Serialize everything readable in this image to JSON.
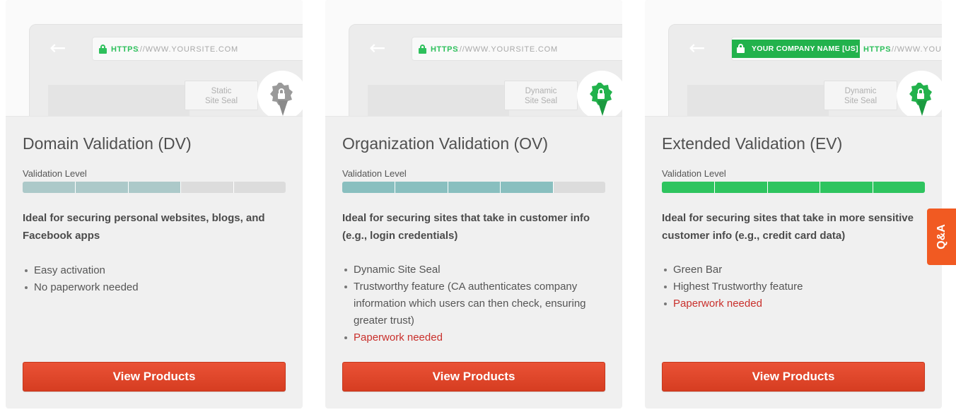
{
  "browser": {
    "https": "HTTPS",
    "domain": "://WWW.YOURSITE.COM",
    "domain_ev": "://WWW.YOU",
    "company": "YOUR COMPANY NAME [US]"
  },
  "cards": [
    {
      "title": "Domain Validation (DV)",
      "seal_line1": "Static",
      "seal_line2": "Site Seal",
      "seal_color": "#9a9a9a",
      "validation_label": "Validation Level",
      "validation_level": 0.6,
      "level_color": "#acc9c9",
      "description": "Ideal for securing personal websites, blogs, and Facebook apps",
      "features": [
        {
          "text": "Easy activation",
          "warning": false
        },
        {
          "text": "No paperwork needed",
          "warning": false
        }
      ],
      "button": "View Products"
    },
    {
      "title": "Organization Validation (OV)",
      "seal_line1": "Dynamic",
      "seal_line2": "Site Seal",
      "seal_color": "#22b24c",
      "validation_label": "Validation Level",
      "validation_level": 0.8,
      "level_color": "#89bfbf",
      "description": "Ideal for securing sites that take in customer info (e.g., login credentials)",
      "features": [
        {
          "text": "Dynamic Site Seal",
          "warning": false
        },
        {
          "text": "Trustworthy feature (CA authenticates company information which users can then check, ensuring greater trust)",
          "warning": false
        },
        {
          "text": "Paperwork needed",
          "warning": true
        }
      ],
      "button": "View Products"
    },
    {
      "title": "Extended Validation (EV)",
      "seal_line1": "Dynamic",
      "seal_line2": "Site Seal",
      "seal_color": "#22b24c",
      "validation_label": "Validation Level",
      "validation_level": 1.0,
      "level_color": "#2ec45f",
      "description": "Ideal for securing sites that take in more sensitive customer info (e.g., credit card data)",
      "features": [
        {
          "text": "Green Bar",
          "warning": false
        },
        {
          "text": "Highest Trustworthy feature",
          "warning": false
        },
        {
          "text": "Paperwork needed",
          "warning": true
        }
      ],
      "button": "View Products"
    }
  ],
  "qa_tab": "Q&A",
  "colors": {
    "accent": "#e04a2c",
    "warning": "#c9302c",
    "qa": "#f15a22"
  }
}
